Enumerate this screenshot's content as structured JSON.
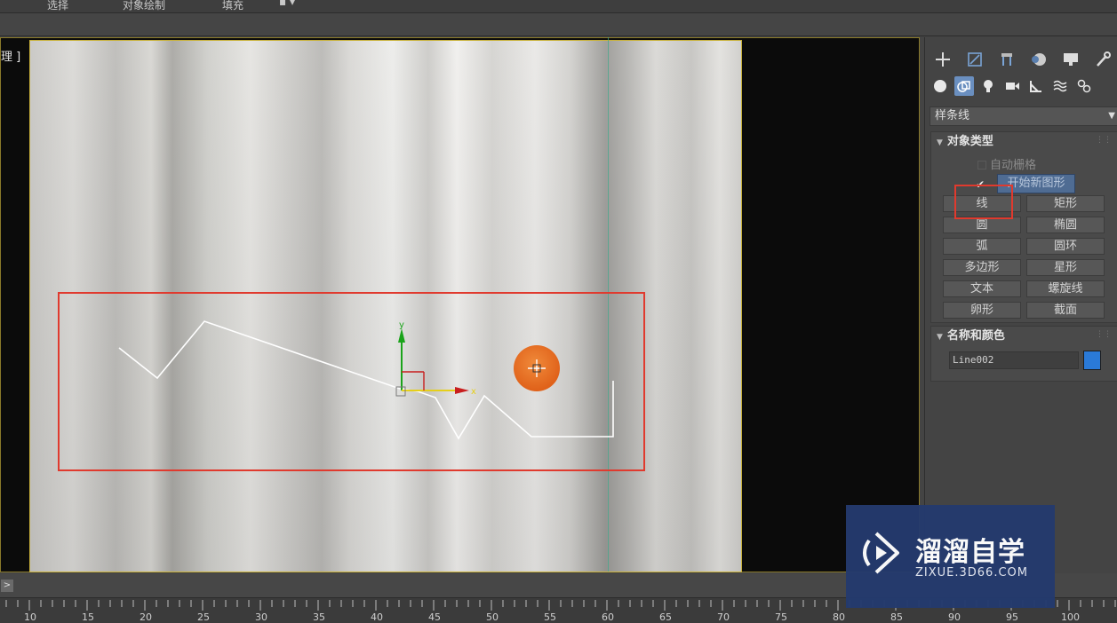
{
  "menu": {
    "items": [
      "选择",
      "对象绘制",
      "填充"
    ]
  },
  "viewport": {
    "label": "理 ]",
    "gizmo": {
      "x_axis": "x",
      "y_axis": "y"
    }
  },
  "command_panel": {
    "category_dropdown": "样条线",
    "object_type": {
      "title": "对象类型",
      "autogrid_label": "自动栅格",
      "start_new_shape_label": "开始新图形",
      "buttons": [
        "线",
        "矩形",
        "圆",
        "椭圆",
        "弧",
        "圆环",
        "多边形",
        "星形",
        "文本",
        "螺旋线",
        "卵形",
        "截面"
      ]
    },
    "name_and_color": {
      "title": "名称和颜色",
      "name_value": "Line002",
      "color": "#2a7ad8"
    }
  },
  "timeline": {
    "ticks": [
      "10",
      "15",
      "20",
      "25",
      "30",
      "35",
      "40",
      "45",
      "50",
      "55",
      "60",
      "65",
      "70",
      "75",
      "80",
      "85",
      "90",
      "95",
      "100"
    ],
    "expand_label": ">"
  },
  "watermark": {
    "title": "溜溜自学",
    "subtitle": "ZIXUE.3D66.COM"
  },
  "colors": {
    "highlight_red": "#e03a2e",
    "accent_blue": "#4f6c93"
  }
}
